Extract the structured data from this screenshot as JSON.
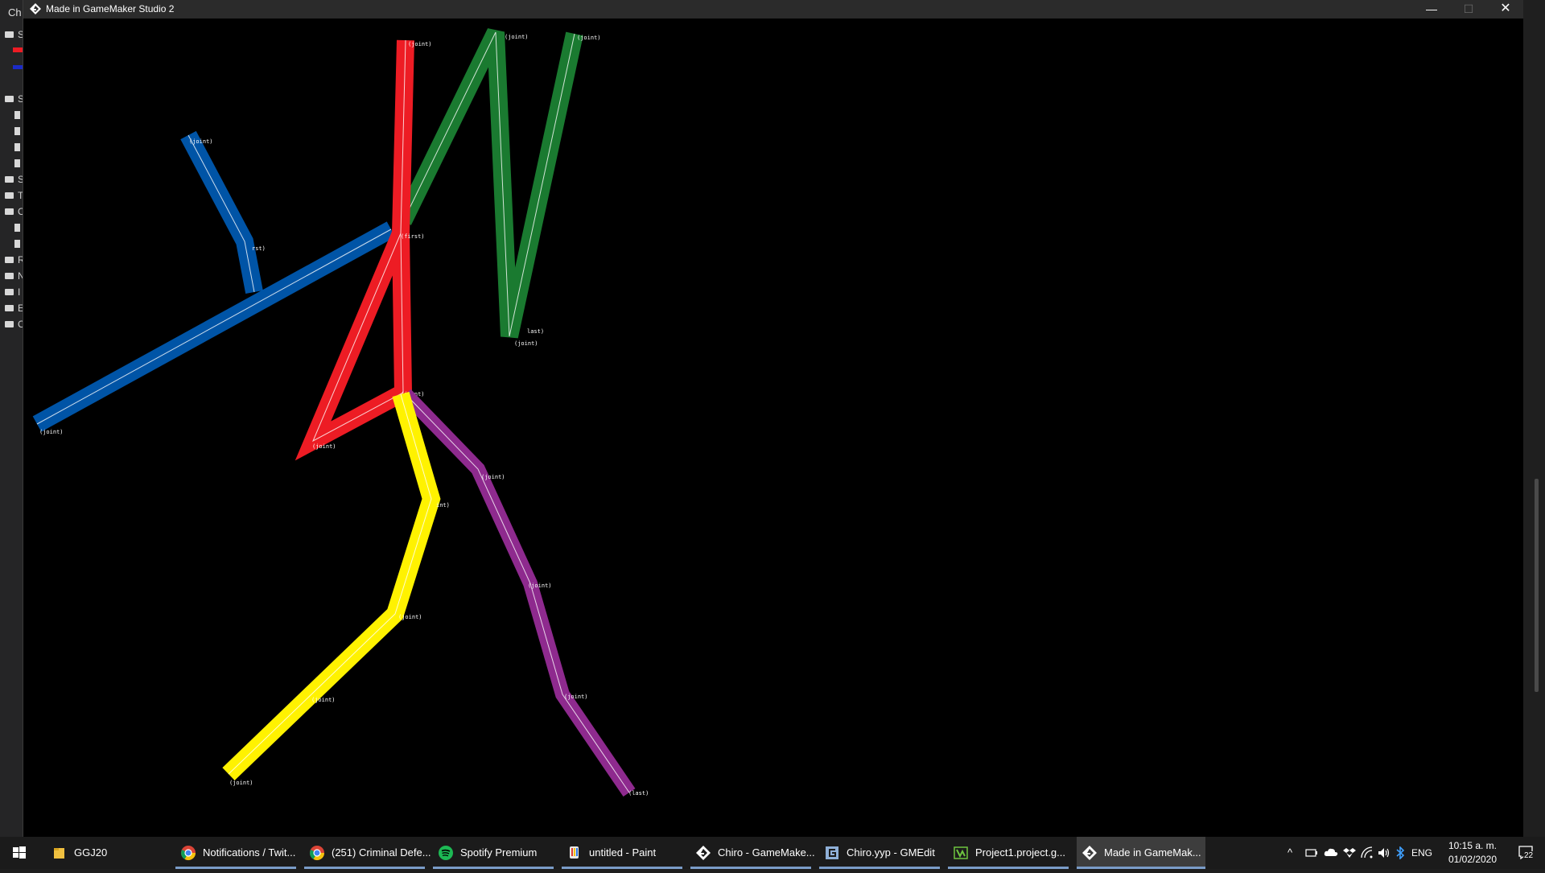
{
  "background_app": {
    "title_fragment": "Ch",
    "tree_letters": [
      "S",
      "S",
      "S",
      "T",
      "C",
      "R",
      "N",
      "I",
      "E",
      "C"
    ]
  },
  "window": {
    "title": "Made in GameMaker Studio 2",
    "controls": {
      "minimize": "—",
      "maximize": "☐",
      "close": "✕"
    },
    "icon": "gamemaker-icon"
  },
  "scene": {
    "background": "#000000",
    "limbs": [
      {
        "name": "red",
        "color": "#ed1c24",
        "labels": [
          "(joint)",
          "(first)",
          "(joint)",
          "(joint)"
        ]
      },
      {
        "name": "green",
        "color": "#1a7a30",
        "labels": [
          "(joint)",
          "(joint)",
          "last)",
          "(joint)"
        ]
      },
      {
        "name": "blue",
        "color": "#0054a6",
        "labels": [
          "(joint)",
          "rst)",
          "(joint)"
        ]
      },
      {
        "name": "yellow",
        "color": "#fff200",
        "labels": [
          "int)",
          "(joint)",
          "(joint)",
          "(joint)"
        ]
      },
      {
        "name": "purple",
        "color": "#8e2a8e",
        "labels": [
          "(joint)",
          "(joint)",
          "(joint)",
          "(last)"
        ]
      }
    ]
  },
  "taskbar": {
    "items": [
      {
        "label": "GGJ20",
        "icon": "folder-icon",
        "color": "#f0c040"
      },
      {
        "label": "Notifications / Twit...",
        "icon": "chrome-icon",
        "color": "#4285f4"
      },
      {
        "label": "(251) Criminal Defe...",
        "icon": "chrome-icon",
        "color": "#4285f4"
      },
      {
        "label": "Spotify Premium",
        "icon": "spotify-icon",
        "color": "#1db954"
      },
      {
        "label": "untitled - Paint",
        "icon": "paint-icon",
        "color": "#e8a0c0"
      },
      {
        "label": "Chiro - GameMake...",
        "icon": "gamemaker-icon",
        "color": "#ffffff"
      },
      {
        "label": "Chiro.yyp - GMEdit",
        "icon": "gmedit-icon",
        "color": "#8fb0d8"
      },
      {
        "label": "Project1.project.g...",
        "icon": "game-icon",
        "color": "#6ec440"
      },
      {
        "label": "Made in GameMak...",
        "icon": "gamemaker-icon",
        "color": "#ffffff",
        "active": true
      }
    ],
    "tray": {
      "language": "ENG",
      "time": "10:15 a. m.",
      "date": "01/02/2020",
      "notification_count": "22"
    }
  }
}
